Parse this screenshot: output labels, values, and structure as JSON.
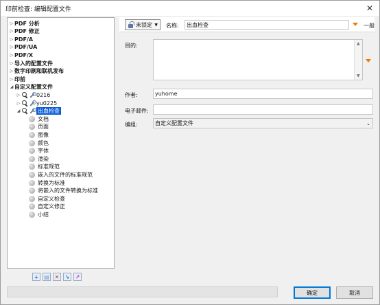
{
  "window": {
    "title": "印前检查: 编辑配置文件",
    "close_glyph": "✕"
  },
  "tree": {
    "top_items": [
      {
        "label": "PDF 分析",
        "expanded": false
      },
      {
        "label": "PDF 修正",
        "expanded": false
      },
      {
        "label": "PDF/A",
        "expanded": false
      },
      {
        "label": "PDF/UA",
        "expanded": false
      },
      {
        "label": "PDF/X",
        "expanded": false
      },
      {
        "label": "导入的配置文件",
        "expanded": false
      },
      {
        "label": "数字印刷和联机发布",
        "expanded": false
      },
      {
        "label": "印前",
        "expanded": false
      },
      {
        "label": "自定义配置文件",
        "expanded": true
      }
    ],
    "profiles": [
      {
        "label": "0216"
      },
      {
        "label": "yu0225"
      },
      {
        "label": "出血检查",
        "selected": true
      }
    ],
    "children": [
      "文档",
      "页面",
      "图像",
      "颜色",
      "字体",
      "渲染",
      "标准规范",
      "嵌入的文件的标准规范",
      "转换为标准",
      "将嵌入的文件转换为标准",
      "自定义检查",
      "自定义修正",
      "小结"
    ],
    "tools": [
      "+",
      "▤",
      "✕",
      "↘",
      "↗"
    ],
    "tool_colors": [
      "#2a6bd0",
      "#6a9ad8",
      "#d02828",
      "#1a7fd0",
      "#c038c0"
    ]
  },
  "form": {
    "lock_label": "未锁定",
    "name_label": "名称:",
    "name_value": "出血检查",
    "general_label": "一般",
    "purpose_label": "目的:",
    "purpose_value": "",
    "author_label": "作者:",
    "author_value": "yuhome",
    "email_label": "电子邮件:",
    "email_value": "",
    "group_label": "编组:",
    "group_value": "自定义配置文件",
    "accent_color": "#f07800"
  },
  "footer": {
    "ok_label": "确定",
    "cancel_label": "取消"
  }
}
